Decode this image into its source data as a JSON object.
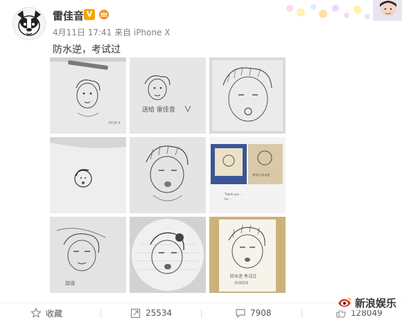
{
  "post": {
    "username": "雷佳音",
    "verified_badge": "V",
    "meta": "4月11日 17:41 来自 iPhone X",
    "text": "防水逆，考试过"
  },
  "images": [
    {
      "name": "sketch-1"
    },
    {
      "name": "sketch-2"
    },
    {
      "name": "sketch-3"
    },
    {
      "name": "sketch-4"
    },
    {
      "name": "sketch-5"
    },
    {
      "name": "sketch-6"
    },
    {
      "name": "sketch-7"
    },
    {
      "name": "sketch-8"
    },
    {
      "name": "sketch-9"
    }
  ],
  "actions": {
    "favorite_label": "收藏",
    "repost_count": "25534",
    "comment_count": "7908",
    "like_count": "128049"
  },
  "watermark": {
    "text": "新浪娱乐"
  },
  "icons": {
    "avatar": "dog-avatar-icon",
    "favorite": "star-icon",
    "repost": "repost-icon",
    "comment": "comment-icon",
    "like": "thumbs-up-icon",
    "watermark": "sina-eye-icon"
  },
  "colors": {
    "vip_orange": "#f7a400",
    "text_dark": "#333333",
    "text_muted": "#808080"
  }
}
